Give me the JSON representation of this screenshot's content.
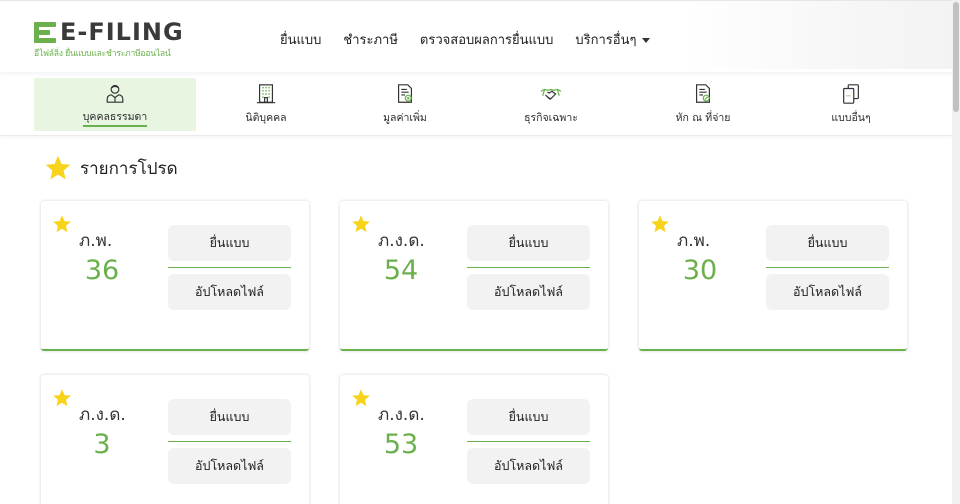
{
  "brand": {
    "logo_text": "E-FILING",
    "logo_sub": "อีไฟล์ลิ่ง ยื่นแบบและชำระภาษีออนไลน์",
    "accent": "#6ab04c"
  },
  "nav": {
    "items": [
      {
        "label": "ยื่นแบบ"
      },
      {
        "label": "ชำระภาษี"
      },
      {
        "label": "ตรวจสอบผลการยื่นแบบ"
      },
      {
        "label": "บริการอื่นๆ"
      }
    ]
  },
  "categories": [
    {
      "label": "บุคคลธรรมดา",
      "icon": "person-icon",
      "active": true
    },
    {
      "label": "นิติบุคคล",
      "icon": "building-icon",
      "active": false
    },
    {
      "label": "มูลค่าเพิ่ม",
      "icon": "document-plus-icon",
      "active": false
    },
    {
      "label": "ธุรกิจเฉพาะ",
      "icon": "handshake-icon",
      "active": false
    },
    {
      "label": "หัก ณ ที่จ่าย",
      "icon": "document-percent-icon",
      "active": false
    },
    {
      "label": "แบบอื่นๆ",
      "icon": "copy-docs-icon",
      "active": false
    }
  ],
  "favorites": {
    "title": "รายการโปรด",
    "cards": [
      {
        "type": "ภ.พ.",
        "number": "36",
        "file_label": "ยื่นแบบ",
        "upload_label": "อัปโหลดไฟล์"
      },
      {
        "type": "ภ.ง.ด.",
        "number": "54",
        "file_label": "ยื่นแบบ",
        "upload_label": "อัปโหลดไฟล์"
      },
      {
        "type": "ภ.พ.",
        "number": "30",
        "file_label": "ยื่นแบบ",
        "upload_label": "อัปโหลดไฟล์"
      },
      {
        "type": "ภ.ง.ด.",
        "number": "3",
        "file_label": "ยื่นแบบ",
        "upload_label": "อัปโหลดไฟล์"
      },
      {
        "type": "ภ.ง.ด.",
        "number": "53",
        "file_label": "ยื่นแบบ",
        "upload_label": "อัปโหลดไฟล์"
      }
    ]
  }
}
